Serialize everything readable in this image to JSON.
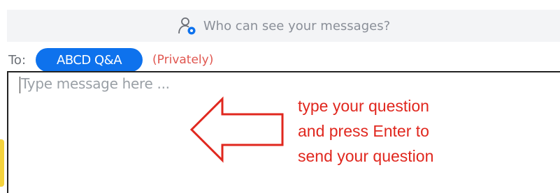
{
  "visibility_bar": {
    "icon": "who-can-see-icon",
    "text": "Who can see your messages?"
  },
  "recipient": {
    "to_label": "To:",
    "selected": "ABCD Q&A",
    "privacy": "(Privately)"
  },
  "message_input": {
    "placeholder": "Type message here ..."
  },
  "annotation": {
    "lines": [
      "type your question",
      "and press Enter to",
      "send your question"
    ]
  },
  "colors": {
    "accent": "#0e72ed",
    "privacy_text": "#e0564f",
    "annotation_red": "#e0271e"
  }
}
